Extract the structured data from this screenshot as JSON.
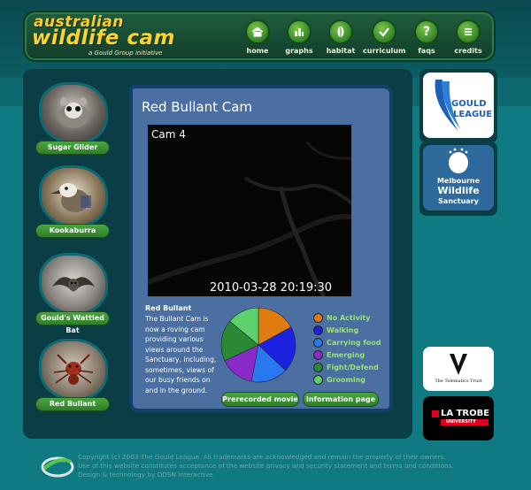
{
  "logo": {
    "line1": "australian",
    "line2": "wildlife cam",
    "line3": "a Gould Group initiative"
  },
  "nav": [
    {
      "label": "home",
      "icon": "house-icon"
    },
    {
      "label": "graphs",
      "icon": "bar-chart-icon"
    },
    {
      "label": "habitat",
      "icon": "leaf-icon"
    },
    {
      "label": "curriculum",
      "icon": "checkmark-icon"
    },
    {
      "label": "faqs",
      "icon": "question-icon"
    },
    {
      "label": "credits",
      "icon": "list-icon"
    }
  ],
  "animals": [
    {
      "label": "Sugar Glider"
    },
    {
      "label": "Kookaburra"
    },
    {
      "label": "Gould's Wattled Bat"
    },
    {
      "label": "Red Bullant"
    }
  ],
  "content": {
    "title": "Red Bullant Cam",
    "camera": "Cam 4",
    "timestamp": "2010-03-28 20:19:30",
    "desc_title": "Red Bullant",
    "desc_text": "The Bullant Cam is now a roving cam providing various views around the Sanctuary, including, sometimes, views of our busy friends on and in the ground.",
    "btn_prerecorded": "Prerecorded movie",
    "btn_info": "Information page"
  },
  "activity": {
    "legend": [
      {
        "label": "No Activity",
        "color": "#e07b10",
        "share": 0.17
      },
      {
        "label": "Walking",
        "color": "#1c22e0",
        "share": 0.2
      },
      {
        "label": "Carrying food",
        "color": "#2a78f0",
        "share": 0.16
      },
      {
        "label": "Emerging",
        "color": "#8a2ac8",
        "share": 0.15
      },
      {
        "label": "Fight/Defend",
        "color": "#2a8a34",
        "share": 0.18
      },
      {
        "label": "Grooming",
        "color": "#5cd06a",
        "share": 0.14
      }
    ]
  },
  "sponsors": {
    "gould_line1": "GOULD",
    "gould_line2": "LEAGUE",
    "melbourne_line1": "Melbourne",
    "melbourne_line2": "Wildlife",
    "melbourne_line3": "Sanctuary",
    "telematics": "The Telematics Trust",
    "latrobe_line1": "LA TROBE",
    "latrobe_line2": "UNIVERSITY"
  },
  "footer": {
    "line1": "Copyright (c) 2003 The Gould League. All trademarks are acknowledged and remain the property of their owners.",
    "line2": "Use of this website constitutes acceptance of the website privacy and security statement and terms and conditions.",
    "line3": "Design & technology by DDSN Interactive."
  }
}
